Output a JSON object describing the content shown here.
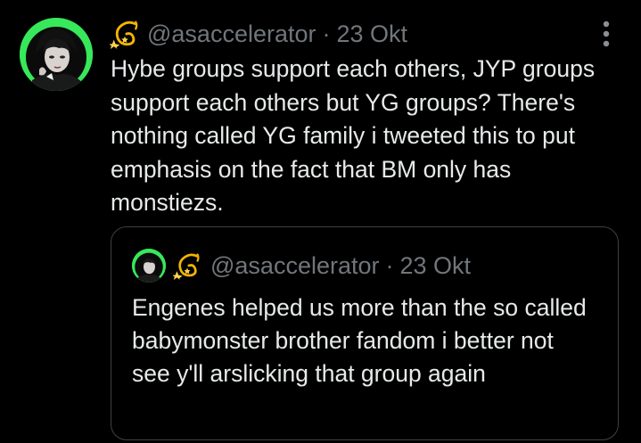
{
  "tweet": {
    "handle": "@asaccelerator",
    "separator": "·",
    "date": "23 Okt",
    "badge_icon": "dizzy-emoji",
    "text": "Hybe groups support each others, JYP groups support each others but YG groups? There's nothing called YG family i tweeted this to put emphasis on the fact that BM only has monstiezs.",
    "more_icon": "more-vertical-icon"
  },
  "quote": {
    "handle": "@asaccelerator",
    "separator": "·",
    "date": "23 Okt",
    "badge_icon": "dizzy-emoji",
    "text": "Engenes helped us more than the so called babymonster brother fandom i better not see y'll arslicking that group again"
  },
  "colors": {
    "background": "#000000",
    "text": "#e7e9ea",
    "muted": "#71767b",
    "avatar_bg": "#37e85a",
    "border": "#3d4145"
  }
}
